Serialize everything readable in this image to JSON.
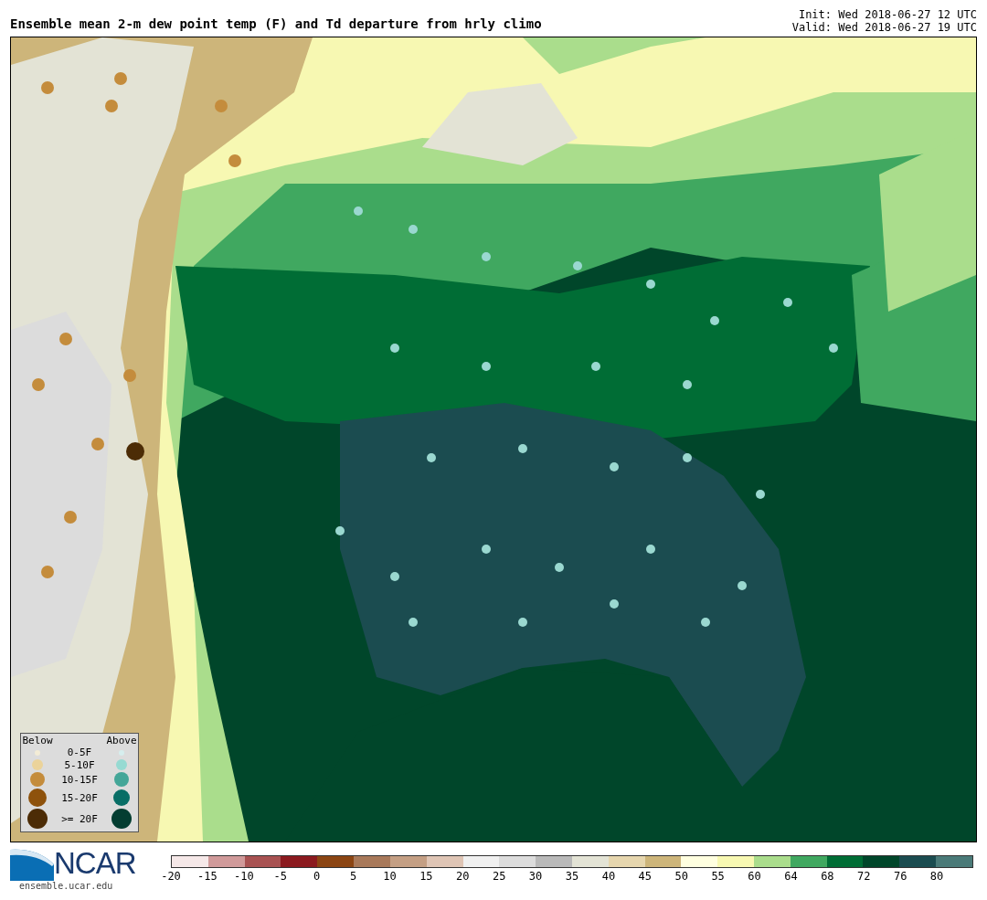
{
  "title": "Ensemble mean 2-m dew point temp (F) and Td departure from hrly climo",
  "init": "Init: Wed 2018-06-27 12 UTC",
  "valid": "Valid: Wed 2018-06-27 19 UTC",
  "legend": {
    "below_heading": "Below",
    "above_heading": "Above",
    "rows": [
      {
        "label": "0-5F",
        "below": {
          "color": "#f3ecd6"
        },
        "above": {
          "color": "#d6eeee"
        }
      },
      {
        "label": "5-10F",
        "below": {
          "color": "#ebd39a"
        },
        "above": {
          "color": "#96dad2"
        }
      },
      {
        "label": "10-15F",
        "below": {
          "color": "#c48c3c"
        },
        "above": {
          "color": "#44a698"
        }
      },
      {
        "label": "15-20F",
        "below": {
          "color": "#8e520c"
        },
        "above": {
          "color": "#086e66"
        }
      },
      {
        "label": ">= 20F",
        "below": {
          "color": "#4c2c06"
        },
        "above": {
          "color": "#033d31"
        }
      }
    ]
  },
  "logo": {
    "text": "NCAR",
    "url": "ensemble.ucar.edu"
  },
  "colorbar": {
    "segments": [
      {
        "color": "#f5e8e8"
      },
      {
        "color": "#d09a9a"
      },
      {
        "color": "#a85252"
      },
      {
        "color": "#8b1a1f"
      },
      {
        "color": "#8b4513"
      },
      {
        "color": "#a8795a"
      },
      {
        "color": "#c49f84"
      },
      {
        "color": "#dfc5b5"
      },
      {
        "color": "#f0f0f0"
      },
      {
        "color": "#dcdcdc"
      },
      {
        "color": "#b9b9b9"
      },
      {
        "color": "#e3e3d5"
      },
      {
        "color": "#e6d6ae"
      },
      {
        "color": "#cdb57a"
      },
      {
        "color": "#ffffe0"
      },
      {
        "color": "#f7f8b2"
      },
      {
        "color": "#aadd8c"
      },
      {
        "color": "#40a860"
      },
      {
        "color": "#006d35"
      },
      {
        "color": "#00462a"
      },
      {
        "color": "#1b4c50"
      },
      {
        "color": "#4a7a78"
      }
    ],
    "ticks": [
      "-20",
      "-15",
      "-10",
      "-5",
      "0",
      "5",
      "10",
      "15",
      "20",
      "25",
      "30",
      "35",
      "40",
      "45",
      "50",
      "55",
      "60",
      "64",
      "68",
      "72",
      "76",
      "80"
    ]
  }
}
